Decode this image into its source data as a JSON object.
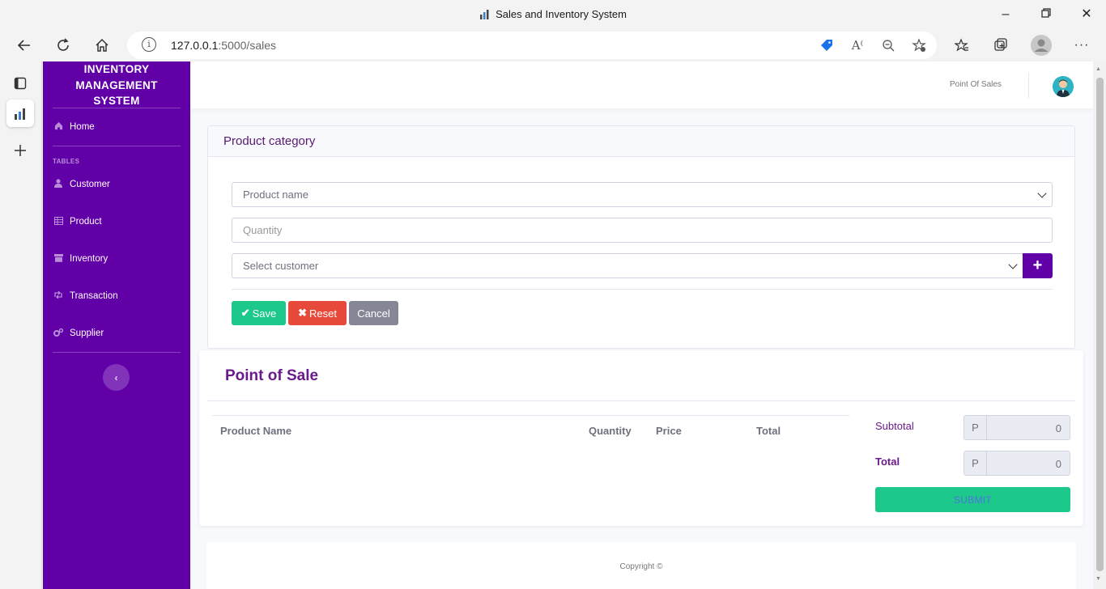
{
  "window": {
    "title": "Sales and Inventory System",
    "url_host": "127.0.0.1",
    "url_path": ":5000/sales"
  },
  "sidebar": {
    "brand_line1": "INVENTORY",
    "brand_line2": "MANAGEMENT",
    "brand_line3": "SYSTEM",
    "home_label": "Home",
    "section_label": "TABLES",
    "items": [
      {
        "label": "Customer",
        "icon": "user-icon"
      },
      {
        "label": "Product",
        "icon": "table-icon"
      },
      {
        "label": "Inventory",
        "icon": "archive-icon"
      },
      {
        "label": "Transaction",
        "icon": "retweet-icon"
      },
      {
        "label": "Supplier",
        "icon": "cogs-icon"
      }
    ]
  },
  "topbar": {
    "link": "Point Of Sales"
  },
  "form": {
    "title": "Product category",
    "product_placeholder": "Product name",
    "quantity_placeholder": "Quantity",
    "customer_placeholder": "Select customer",
    "save_label": "Save",
    "reset_label": "Reset",
    "cancel_label": "Cancel"
  },
  "pos": {
    "title": "Point of Sale",
    "columns": [
      "Product Name",
      "Quantity",
      "Price",
      "Total"
    ],
    "subtotal_label": "Subtotal",
    "total_label": "Total",
    "currency_prefix": "P",
    "subtotal_value": "0",
    "total_value": "0",
    "submit_label": "SUBMIT"
  },
  "footer": {
    "text": "Copyright ©"
  },
  "colors": {
    "sidebar": "#6200a8",
    "success": "#1cc88a",
    "danger": "#e74a3b",
    "secondary": "#858796",
    "heading": "#6a1a8a"
  }
}
